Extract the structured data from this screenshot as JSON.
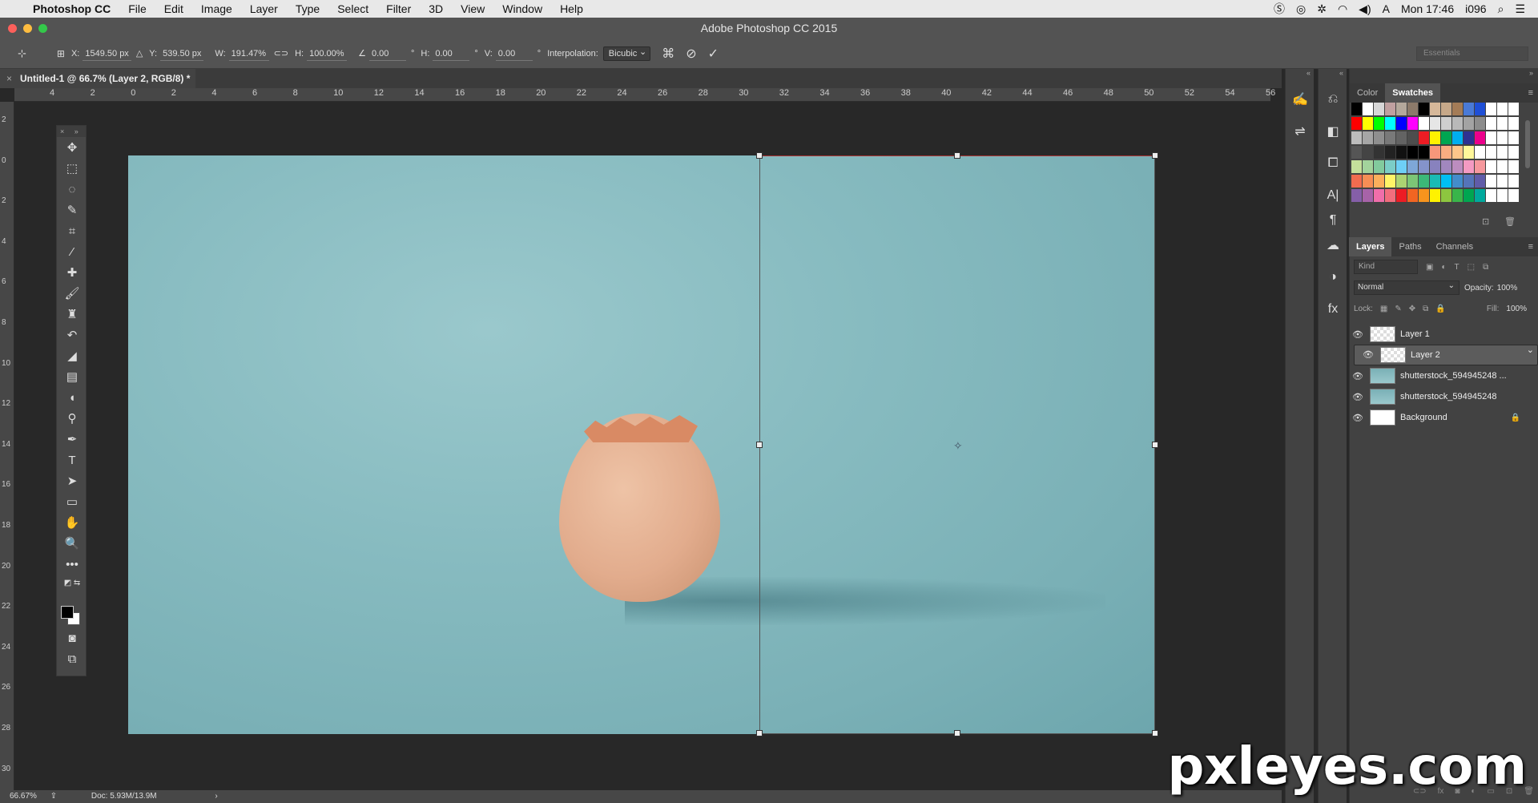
{
  "menubar": {
    "app_name": "Photoshop CC",
    "items": [
      "File",
      "Edit",
      "Image",
      "Layer",
      "Type",
      "Select",
      "Filter",
      "3D",
      "View",
      "Window",
      "Help"
    ],
    "clock": "Mon 17:46",
    "user": "i096"
  },
  "window": {
    "title": "Adobe Photoshop CC 2015"
  },
  "options": {
    "x_label": "X:",
    "x_value": "1549.50 px",
    "y_label": "Y:",
    "y_value": "539.50 px",
    "w_label": "W:",
    "w_value": "191.47%",
    "h_label": "H:",
    "h_value": "100.00%",
    "angle_value": "0.00",
    "hskew_label": "H:",
    "hskew_value": "0.00",
    "vskew_label": "V:",
    "vskew_value": "0.00",
    "deg": "°",
    "interp_label": "Interpolation:",
    "interp_value": "Bicubic",
    "workspace": "Essentials"
  },
  "document": {
    "tab_title": "Untitled-1 @ 66.7% (Layer 2, RGB/8) *"
  },
  "ruler": {
    "h_ticks": [
      "4",
      "2",
      "0",
      "2",
      "4",
      "6",
      "8",
      "10",
      "12",
      "14",
      "16",
      "18",
      "20",
      "22",
      "24",
      "26",
      "28",
      "30",
      "32",
      "34",
      "36",
      "38",
      "40",
      "42",
      "44",
      "46",
      "48",
      "50",
      "52",
      "54",
      "56"
    ],
    "v_ticks": [
      "2",
      "0",
      "2",
      "4",
      "6",
      "8",
      "10",
      "12",
      "14",
      "16",
      "18",
      "20",
      "22",
      "24",
      "26",
      "28",
      "30"
    ]
  },
  "status": {
    "zoom": "66.67%",
    "doc": "Doc: 5.93M/13.9M"
  },
  "panels": {
    "color_tabs": [
      "Color",
      "Swatches"
    ],
    "layers_tabs": [
      "Layers",
      "Paths",
      "Channels"
    ],
    "kind_placeholder": "Kind",
    "blend_mode": "Normal",
    "opacity_label": "Opacity:",
    "opacity_value": "100%",
    "lock_label": "Lock:",
    "fill_label": "Fill:",
    "fill_value": "100%",
    "layers": [
      {
        "name": "Layer 1"
      },
      {
        "name": "Layer 2"
      },
      {
        "name": "shutterstock_594945248 ..."
      },
      {
        "name": "shutterstock_594945248"
      },
      {
        "name": "Background"
      }
    ]
  },
  "swatches": [
    "#000000",
    "#ffffff",
    "#d7d7d7",
    "#c0a0a0",
    "#b4a89b",
    "#8c7a6a",
    "#000000",
    "#d6b89a",
    "#c6a889",
    "#a47c57",
    "#4a7ad6",
    "#1f4fd6",
    "#ffffff",
    "#ffffff",
    "#ffffff",
    "#ff0000",
    "#ffff00",
    "#00ff00",
    "#00ffff",
    "#0000ff",
    "#ff00ff",
    "#ffffff",
    "#e6e6e6",
    "#cfcfcf",
    "#b9b9b9",
    "#a3a3a3",
    "#8c8c8c",
    "#ffffff",
    "#ffffff",
    "#ffffff",
    "#bcbcbc",
    "#a6a6a6",
    "#8f8f8f",
    "#797979",
    "#636363",
    "#4d4d4d",
    "#ed1c24",
    "#fff200",
    "#00a651",
    "#00aeef",
    "#2e3192",
    "#ec008c",
    "#ffffff",
    "#ffffff",
    "#ffffff",
    "#555555",
    "#444444",
    "#333333",
    "#222222",
    "#111111",
    "#000000",
    "#000000",
    "#f7977a",
    "#f9ad81",
    "#fdc68a",
    "#fff79a",
    "#ffffff",
    "#ffffff",
    "#ffffff",
    "#ffffff",
    "#c4df9b",
    "#a3d39c",
    "#82ca9d",
    "#7bcdc8",
    "#6ecff6",
    "#7ea7d8",
    "#8493ca",
    "#8882be",
    "#a187be",
    "#bc8dbf",
    "#f49ac2",
    "#f6989d",
    "#ffffff",
    "#ffffff",
    "#ffffff",
    "#f26c4f",
    "#f68e55",
    "#fbaf5c",
    "#fff467",
    "#acd372",
    "#7cc576",
    "#3bb878",
    "#1abbb4",
    "#00bff3",
    "#438ccb",
    "#5574b9",
    "#605ca8",
    "#ffffff",
    "#ffffff",
    "#ffffff",
    "#855fa8",
    "#a763a8",
    "#f06eaa",
    "#f26d7d",
    "#ed1c24",
    "#f26522",
    "#f7941d",
    "#fff200",
    "#8dc63f",
    "#39b54a",
    "#00a651",
    "#00a99d",
    "#ffffff",
    "#ffffff",
    "#ffffff"
  ],
  "watermark": "pxleyes.com"
}
